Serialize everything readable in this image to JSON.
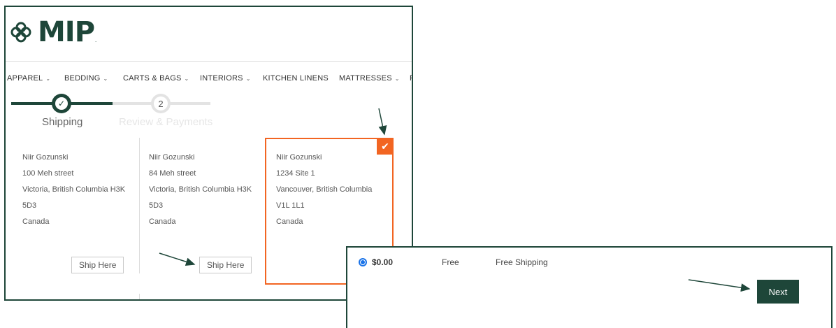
{
  "brand": {
    "logo_text": "MIP",
    "logo_suffix": "."
  },
  "nav": {
    "items": [
      {
        "label": "APPAREL",
        "has_dropdown": true
      },
      {
        "label": "BEDDING",
        "has_dropdown": true
      },
      {
        "label": "CARTS & BAGS",
        "has_dropdown": true
      },
      {
        "label": "INTERIORS",
        "has_dropdown": true
      },
      {
        "label": "KITCHEN LINENS",
        "has_dropdown": false
      },
      {
        "label": "MATTRESSES",
        "has_dropdown": true
      },
      {
        "label": "R",
        "has_dropdown": false
      }
    ]
  },
  "progress": {
    "step1_label": "Shipping",
    "step2_number": "2",
    "step2_label": "Review & Payments"
  },
  "addresses": [
    {
      "name": "Niir Gozunski",
      "street": "100 Meh street",
      "city_line": "Victoria, British Columbia H3K",
      "postal": "5D3",
      "country": "Canada",
      "button": "Ship Here"
    },
    {
      "name": "Niir Gozunski",
      "street": "84 Meh street",
      "city_line": "Victoria, British Columbia H3K",
      "postal": "5D3",
      "country": "Canada",
      "button": "Ship Here"
    },
    {
      "name": "Niir Gozunski",
      "street": "1234 Site 1",
      "city_line": "Vancouver, British Columbia",
      "postal": "V1L 1L1",
      "country": "Canada",
      "selected": true
    }
  ],
  "shipping": {
    "price": "$0.00",
    "method": "Free",
    "carrier": "Free Shipping",
    "next_label": "Next"
  },
  "colors": {
    "brand_green": "#1e4639",
    "selected_orange": "#f26522",
    "radio_blue": "#1a73e8"
  }
}
